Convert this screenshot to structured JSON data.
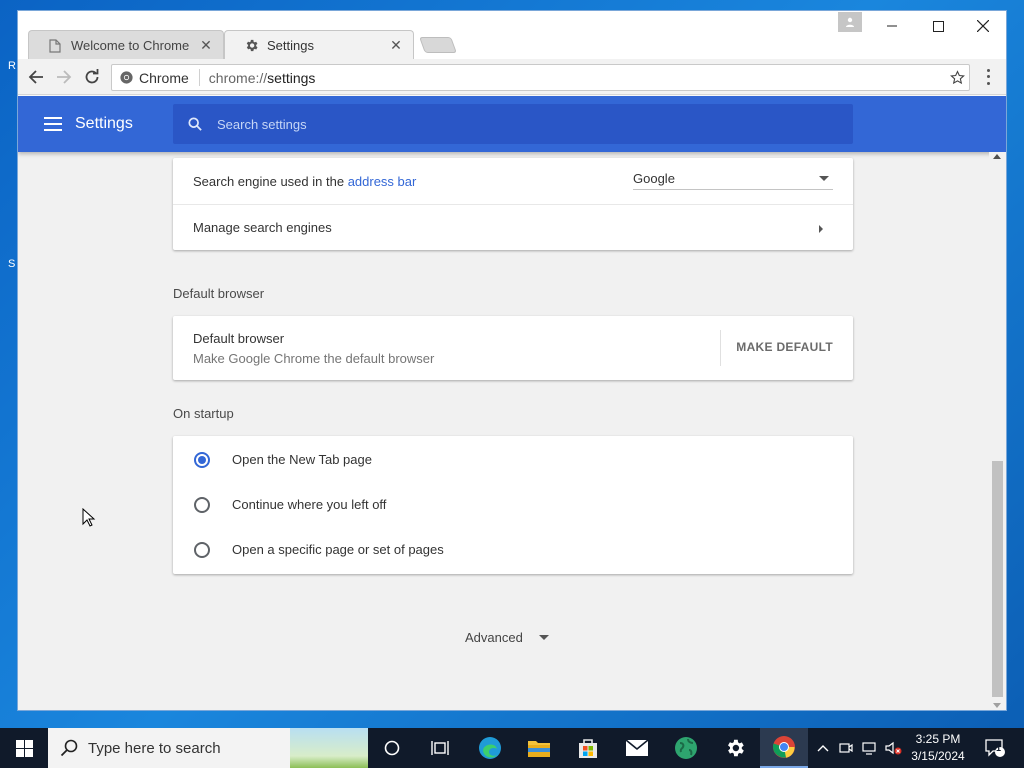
{
  "browser": {
    "tabs": [
      {
        "title": "Welcome to Chrome",
        "icon": "page-icon",
        "active": false
      },
      {
        "title": "Settings",
        "icon": "gear-icon",
        "active": true
      }
    ],
    "omnibox": {
      "site_label": "Chrome",
      "url_prefix": "chrome://",
      "url_path": "settings"
    }
  },
  "settings": {
    "header_title": "Settings",
    "search_placeholder": "Search settings",
    "search_engine": {
      "label_prefix": "Search engine used in the",
      "label_link": "address bar",
      "selected": "Google"
    },
    "manage_search_engines": "Manage search engines",
    "default_browser": {
      "section_title": "Default browser",
      "primary": "Default browser",
      "secondary": "Make Google Chrome the default browser",
      "button": "MAKE DEFAULT"
    },
    "on_startup": {
      "section_title": "On startup",
      "options": [
        {
          "label": "Open the New Tab page",
          "checked": true
        },
        {
          "label": "Continue where you left off",
          "checked": false
        },
        {
          "label": "Open a specific page or set of pages",
          "checked": false
        }
      ]
    },
    "advanced_label": "Advanced"
  },
  "taskbar": {
    "search_placeholder": "Type here to search",
    "time": "3:25 PM",
    "date": "3/15/2024",
    "notification_count": "1"
  },
  "colors": {
    "accent": "#3367d6",
    "header_search": "#2a56c6",
    "page_bg": "#f1f1f1"
  }
}
